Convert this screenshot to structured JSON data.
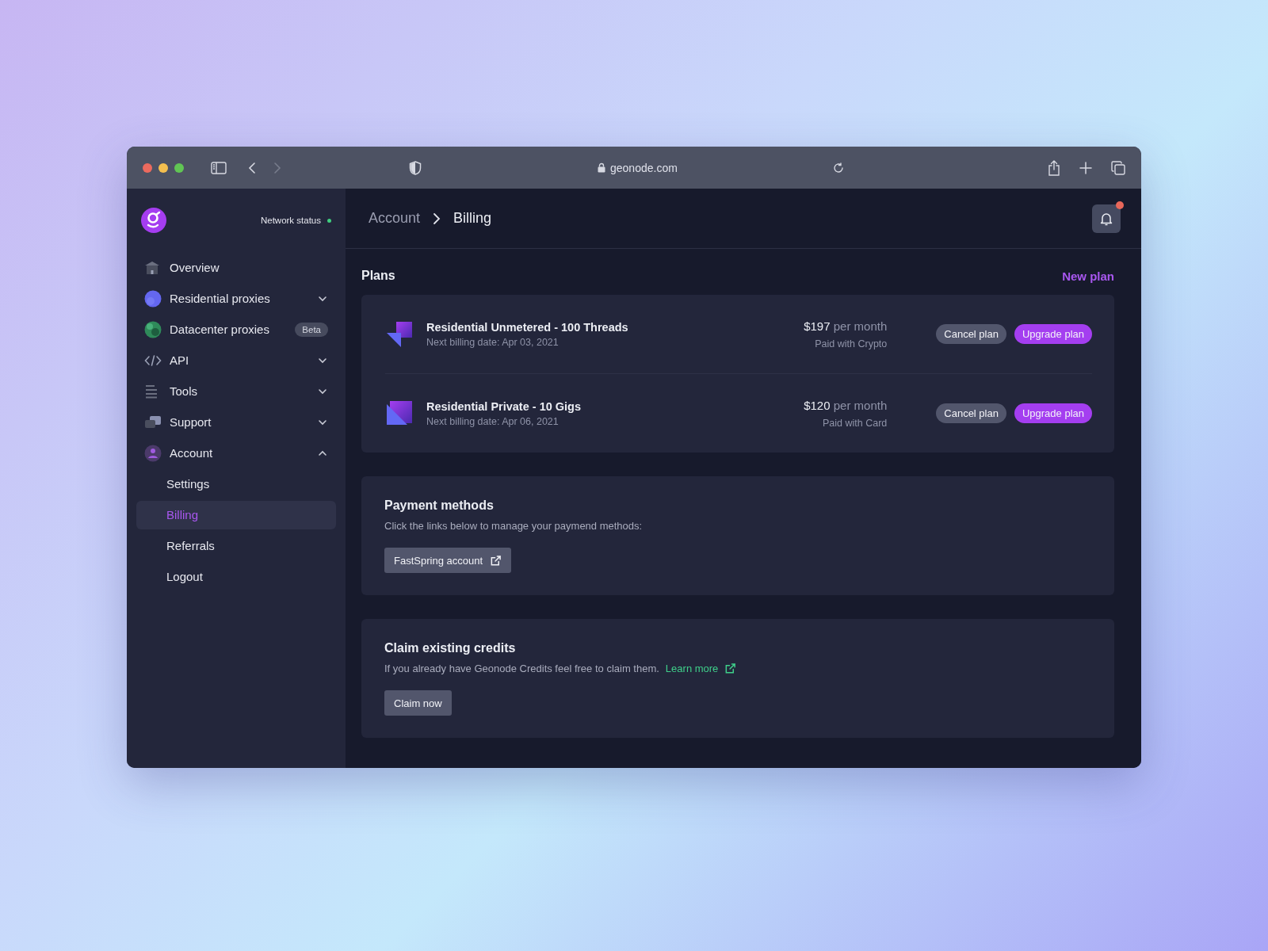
{
  "browser": {
    "url": "geonode.com"
  },
  "sidebar": {
    "network_status": {
      "label": "Network status",
      "online": true
    },
    "nav": [
      {
        "label": "Overview"
      },
      {
        "label": "Residential proxies",
        "expanded": false
      },
      {
        "label": "Datacenter proxies",
        "badge": "Beta"
      },
      {
        "label": "API",
        "expanded": false
      },
      {
        "label": "Tools",
        "expanded": false
      },
      {
        "label": "Support",
        "expanded": false
      },
      {
        "label": "Account",
        "expanded": true,
        "children": [
          {
            "label": "Settings",
            "selected": false
          },
          {
            "label": "Billing",
            "selected": true
          },
          {
            "label": "Referrals",
            "selected": false
          },
          {
            "label": "Logout",
            "selected": false
          }
        ]
      }
    ]
  },
  "header": {
    "breadcrumb": [
      "Account",
      "Billing"
    ],
    "notifications": {
      "unread": true
    }
  },
  "plans": {
    "title": "Plans",
    "new_plan": "New plan",
    "items": [
      {
        "name": "Residential Unmetered - 100 Threads",
        "next_billing": "Next billing date: Apr 03, 2021",
        "price": "$197",
        "period": "per month",
        "paid_with": "Paid with Crypto",
        "cancel": "Cancel plan",
        "upgrade": "Upgrade plan"
      },
      {
        "name": "Residential Private - 10 Gigs",
        "next_billing": "Next billing date: Apr 06, 2021",
        "price": "$120",
        "period": "per month",
        "paid_with": "Paid with Card",
        "cancel": "Cancel plan",
        "upgrade": "Upgrade plan"
      }
    ]
  },
  "payment_methods": {
    "title": "Payment methods",
    "description": "Click the links below to manage your paymend methods:",
    "button": "FastSpring account"
  },
  "credits": {
    "title": "Claim existing credits",
    "description": "If you already have Geonode Credits feel free to claim them.",
    "link": "Learn more",
    "button": "Claim now"
  }
}
